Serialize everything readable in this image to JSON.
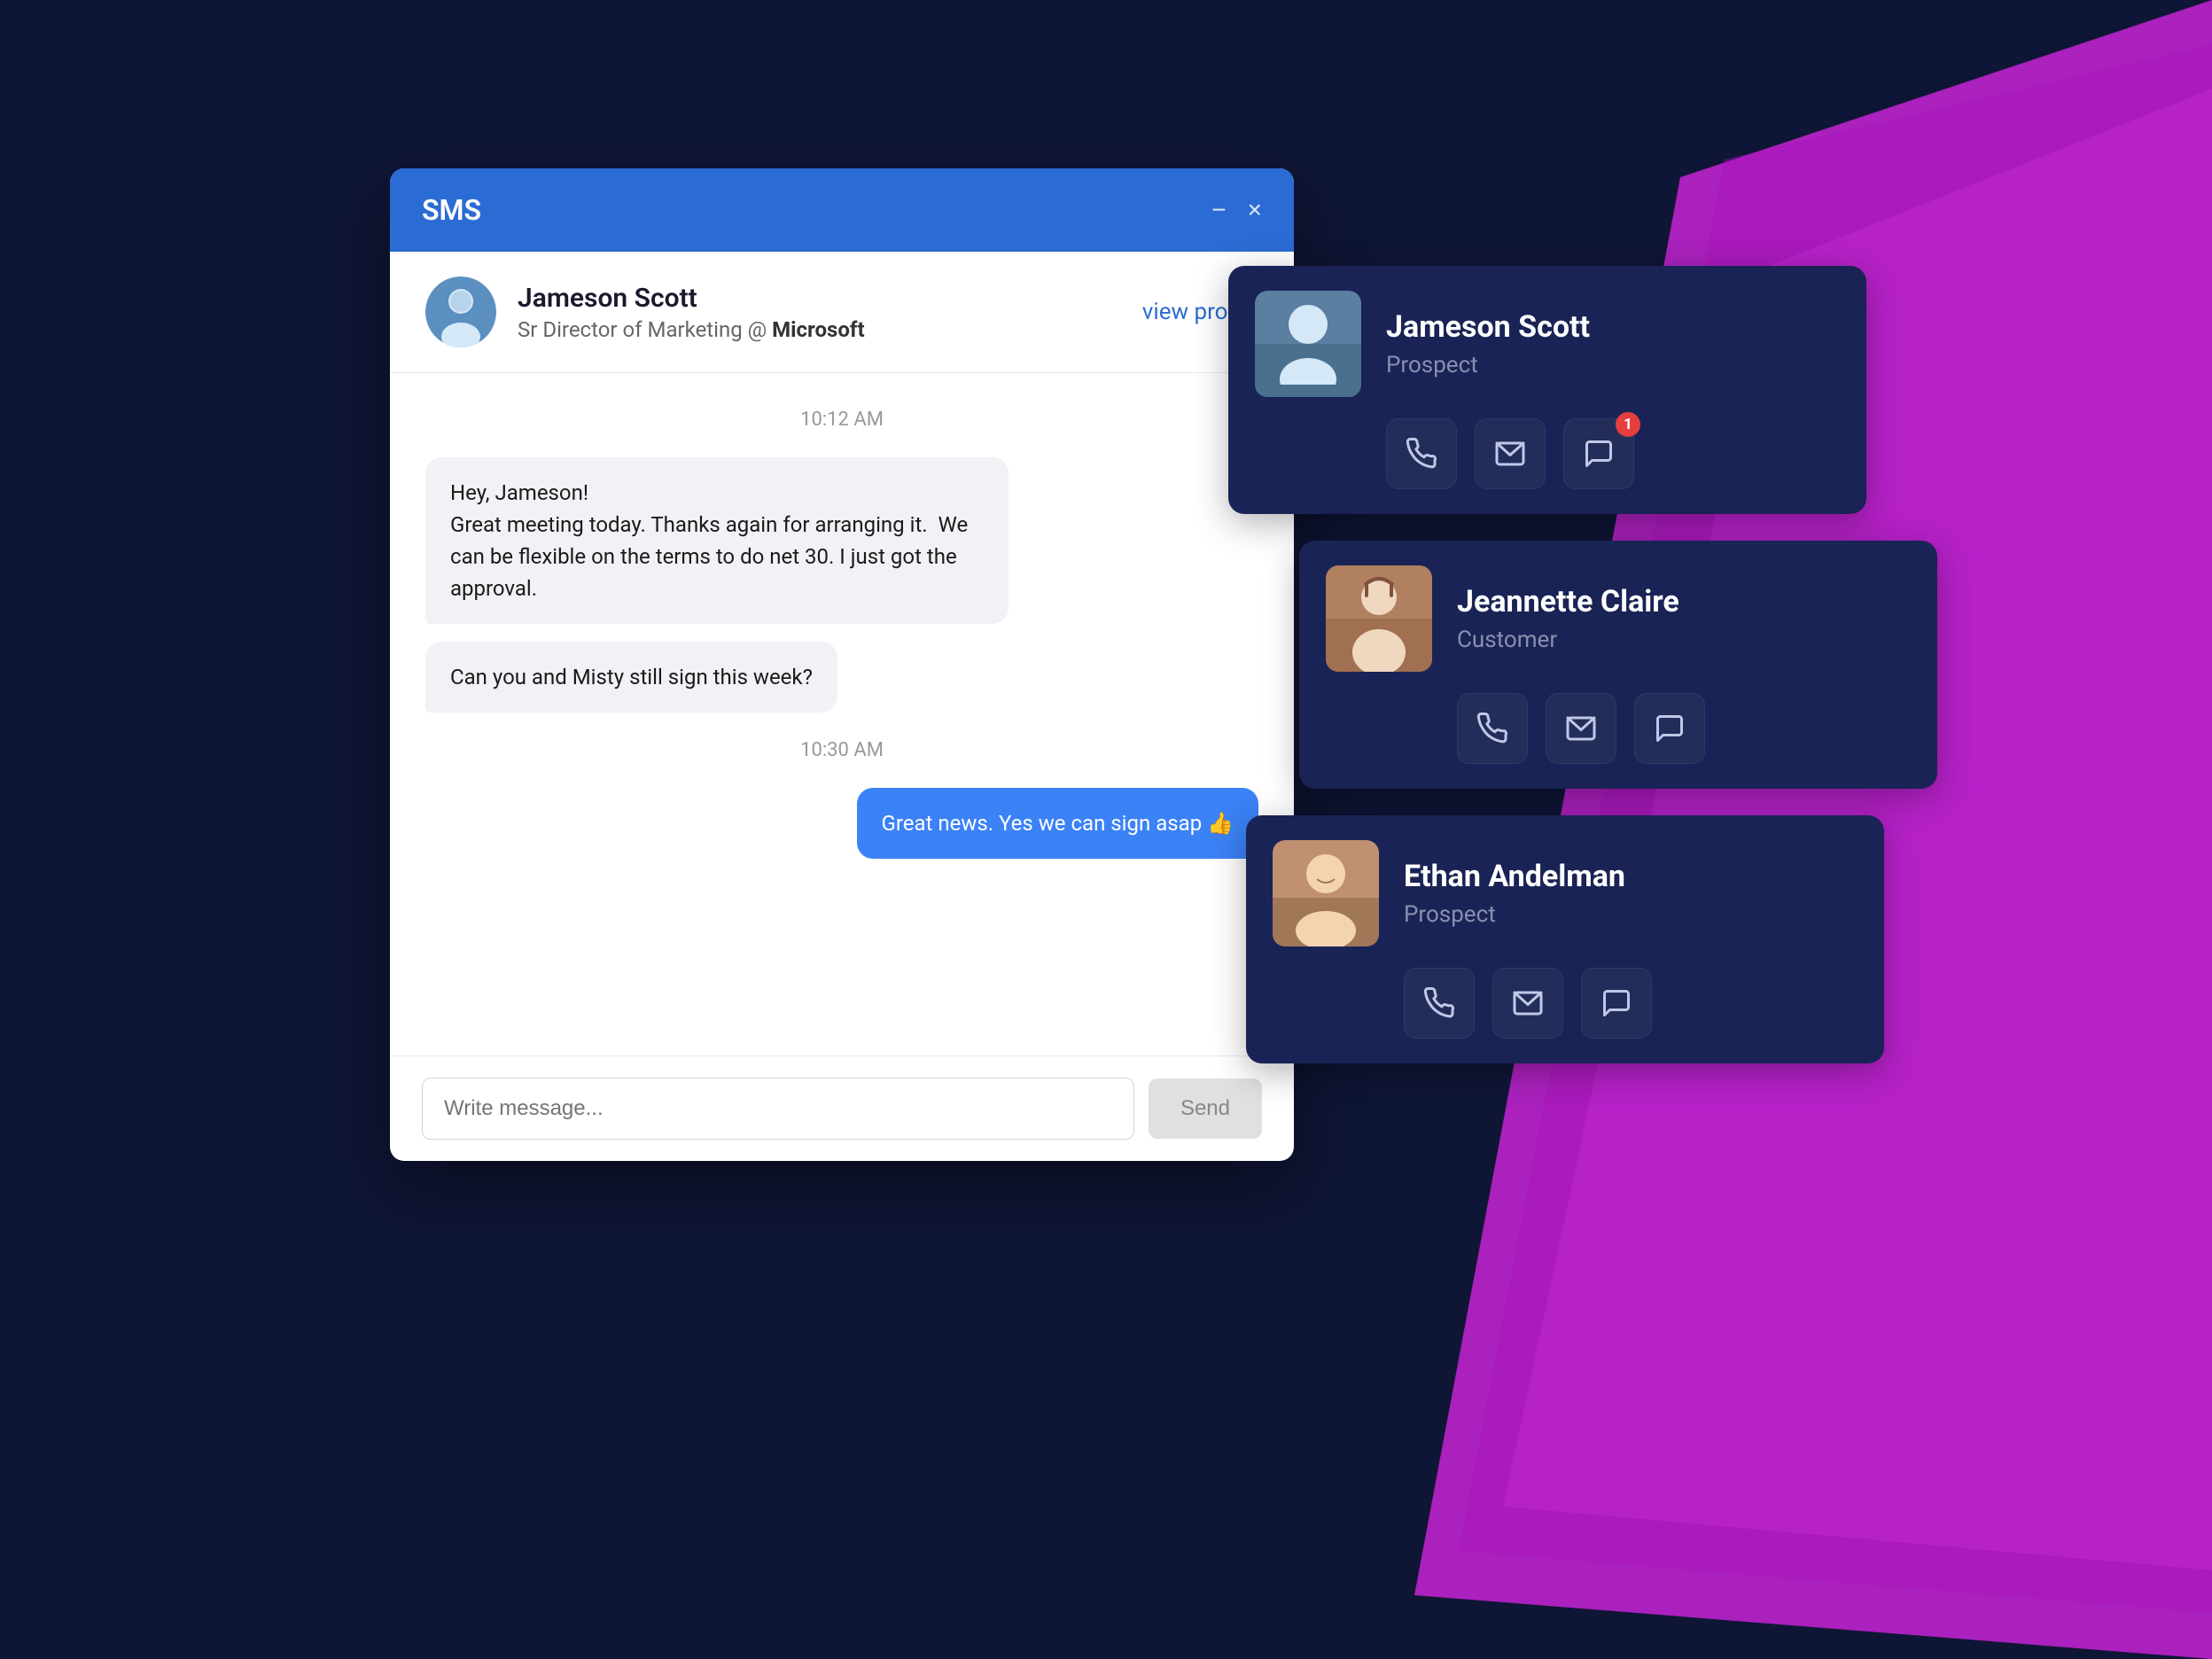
{
  "background": {
    "color": "#0f1535"
  },
  "sms_window": {
    "title": "SMS",
    "minimize_label": "−",
    "close_label": "×",
    "contact": {
      "name": "Jameson Scott",
      "title": "Sr Director of Marketing @ ",
      "company": "Microsoft",
      "view_profile": "view profile"
    },
    "messages": [
      {
        "time": "10:12 AM",
        "type": "received",
        "text": "Hey, Jameson!\nGreat meeting today. Thanks again for arranging it.  We can be flexible on the terms to do net 30. I just got the approval."
      },
      {
        "time": null,
        "type": "received",
        "text": "Can you and Misty still sign this week?"
      },
      {
        "time": "10:30 AM",
        "type": "sent",
        "text": "Great news. Yes we can sign asap 👍"
      }
    ],
    "input": {
      "placeholder": "Write message...",
      "send_label": "Send"
    }
  },
  "contact_cards": [
    {
      "id": "card-jameson",
      "name": "Jameson Scott",
      "role": "Prospect",
      "avatar_color": "#7aa8cc",
      "actions": {
        "phone": "phone",
        "email": "email",
        "sms": "sms",
        "sms_badge": "1"
      }
    },
    {
      "id": "card-jeannette",
      "name": "Jeannette Claire",
      "role": "Customer",
      "avatar_color": "#c4a07a",
      "actions": {
        "phone": "phone",
        "email": "email",
        "sms": "sms",
        "sms_badge": null
      }
    },
    {
      "id": "card-ethan",
      "name": "Ethan Andelman",
      "role": "Prospect",
      "avatar_color": "#d4a880",
      "actions": {
        "phone": "phone",
        "email": "email",
        "sms": "sms",
        "sms_badge": null
      }
    }
  ]
}
